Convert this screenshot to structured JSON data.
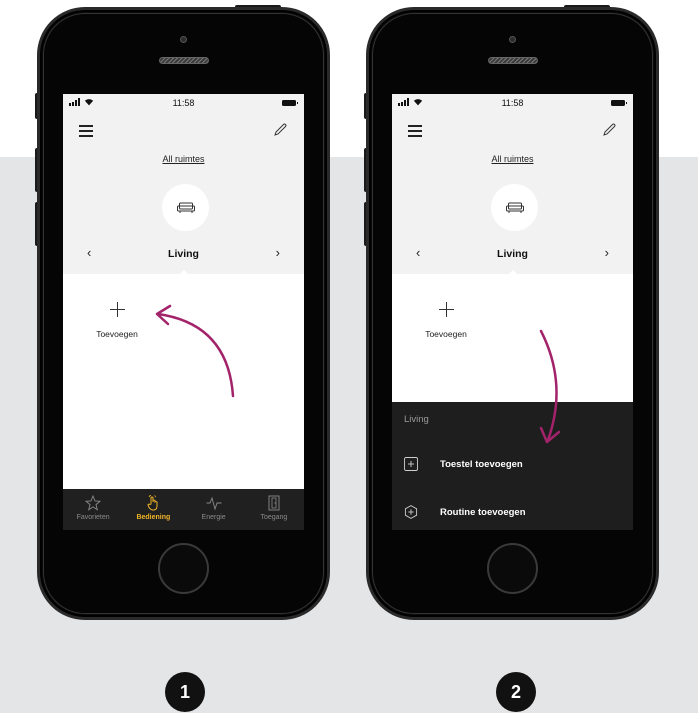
{
  "colors": {
    "accent_active_tab": "#f0b428",
    "arrow": "#a3236b",
    "backdrop": "#e4e5e7"
  },
  "phone1": {
    "status": {
      "time": "11:58"
    },
    "header": {
      "all_rooms": "All ruimtes",
      "menu_icon": "hamburger-icon",
      "edit_icon": "pencil-icon"
    },
    "room": {
      "name": "Living",
      "icon": "sofa-icon",
      "prev": "‹",
      "next": "›"
    },
    "add": {
      "label": "Toevoegen",
      "icon": "plus-icon"
    },
    "tabs": [
      {
        "label": "Favorieten",
        "icon": "star-icon",
        "active": false
      },
      {
        "label": "Bediening",
        "icon": "hand-icon",
        "active": true
      },
      {
        "label": "Energie",
        "icon": "pulse-icon",
        "active": false
      },
      {
        "label": "Toegang",
        "icon": "door-icon",
        "active": false
      }
    ]
  },
  "phone2": {
    "status": {
      "time": "11:58"
    },
    "header": {
      "all_rooms": "All ruimtes"
    },
    "room": {
      "name": "Living",
      "prev": "‹",
      "next": "›"
    },
    "add": {
      "label": "Toevoegen"
    },
    "sheet": {
      "title": "Living",
      "items": [
        {
          "label": "Toestel toevoegen",
          "icon": "plus-square-icon"
        },
        {
          "label": "Routine toevoegen",
          "icon": "plus-hexagon-icon"
        }
      ]
    }
  },
  "steps": [
    "1",
    "2"
  ]
}
